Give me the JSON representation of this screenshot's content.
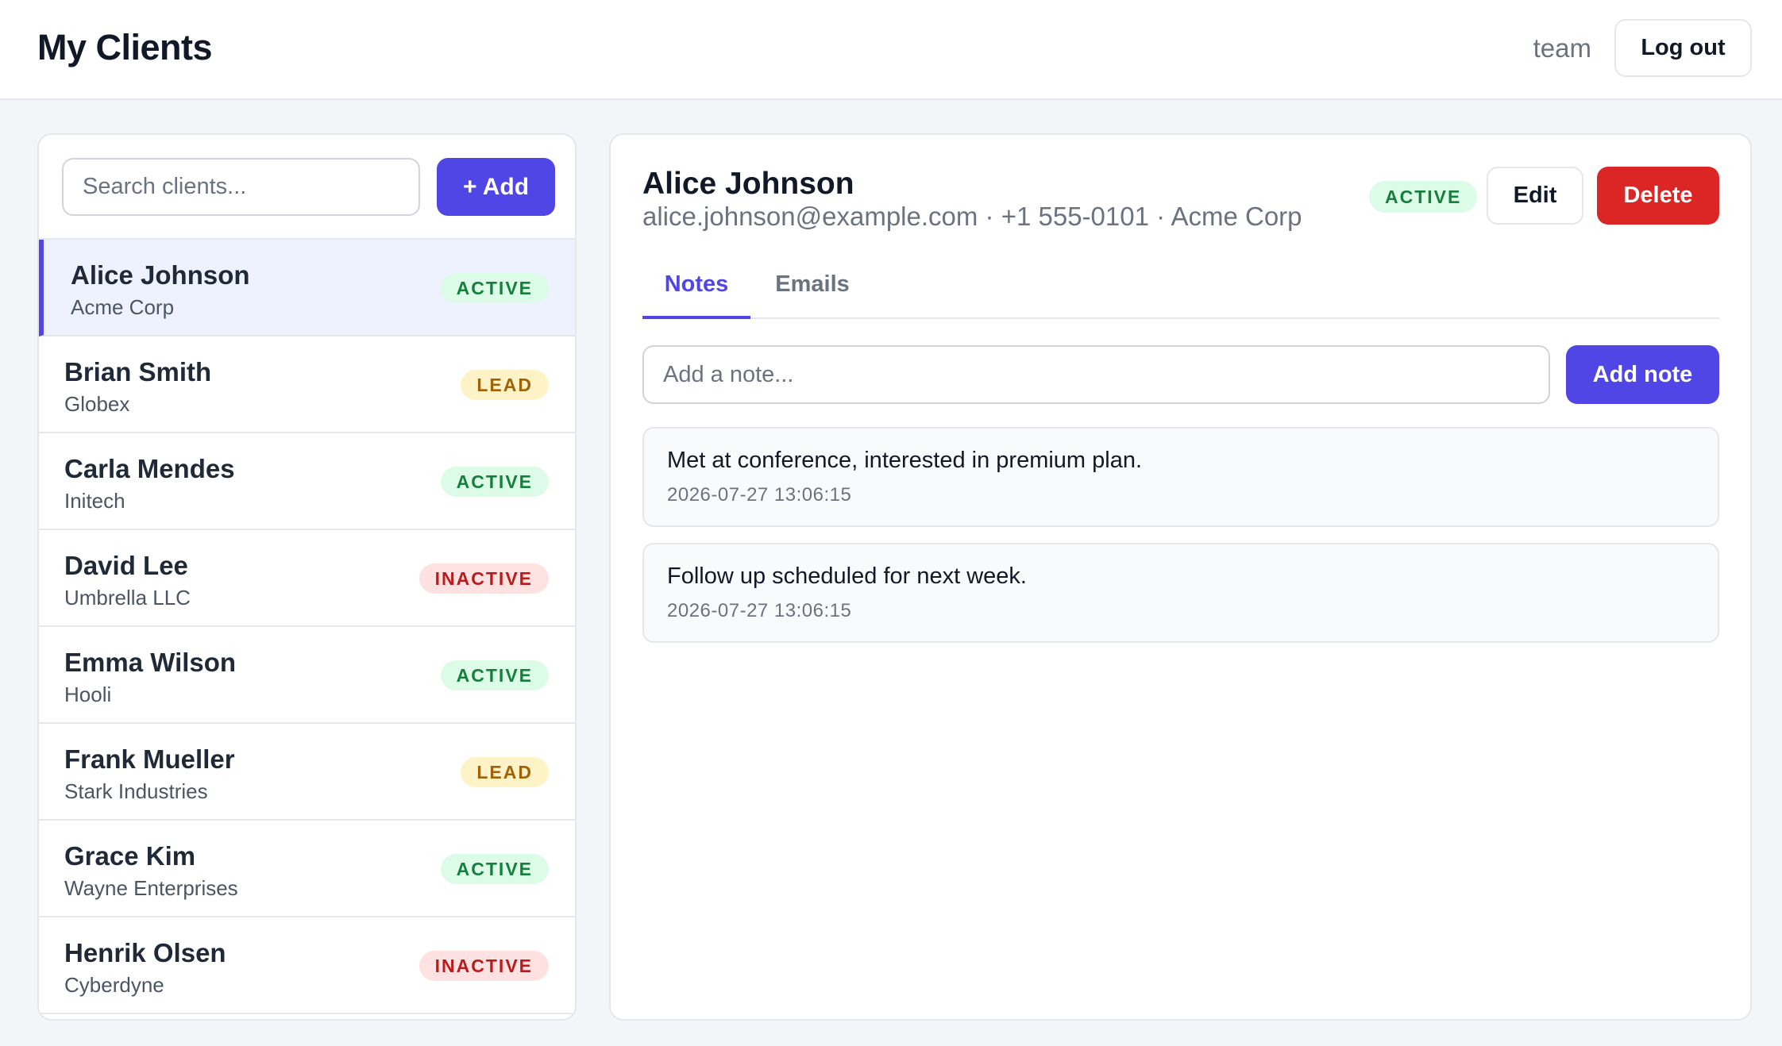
{
  "header": {
    "title": "My Clients",
    "user": "team",
    "logout_label": "Log out"
  },
  "sidebar": {
    "search_placeholder": "Search clients...",
    "add_label": "+ Add",
    "clients": [
      {
        "name": "Alice Johnson",
        "company": "Acme Corp",
        "status": "ACTIVE",
        "selected": true
      },
      {
        "name": "Brian Smith",
        "company": "Globex",
        "status": "LEAD",
        "selected": false
      },
      {
        "name": "Carla Mendes",
        "company": "Initech",
        "status": "ACTIVE",
        "selected": false
      },
      {
        "name": "David Lee",
        "company": "Umbrella LLC",
        "status": "INACTIVE",
        "selected": false
      },
      {
        "name": "Emma Wilson",
        "company": "Hooli",
        "status": "ACTIVE",
        "selected": false
      },
      {
        "name": "Frank Mueller",
        "company": "Stark Industries",
        "status": "LEAD",
        "selected": false
      },
      {
        "name": "Grace Kim",
        "company": "Wayne Enterprises",
        "status": "ACTIVE",
        "selected": false
      },
      {
        "name": "Henrik Olsen",
        "company": "Cyberdyne",
        "status": "INACTIVE",
        "selected": false
      }
    ]
  },
  "detail": {
    "name": "Alice Johnson",
    "meta": "alice.johnson@example.com · +1 555-0101 · Acme Corp",
    "status": "ACTIVE",
    "edit_label": "Edit",
    "delete_label": "Delete",
    "tabs": [
      {
        "label": "Notes",
        "active": true
      },
      {
        "label": "Emails",
        "active": false
      }
    ],
    "note_placeholder": "Add a note...",
    "add_note_label": "Add note",
    "notes": [
      {
        "text": "Met at conference, interested in premium plan.",
        "time": "2026-07-27 13:06:15"
      },
      {
        "text": "Follow up scheduled for next week.",
        "time": "2026-07-27 13:06:15"
      }
    ]
  },
  "colors": {
    "accent": "#4f46e5",
    "danger": "#dc2626",
    "active_bg": "#dcfce7",
    "active_fg": "#15803d",
    "lead_bg": "#fef3c7",
    "lead_fg": "#a16207",
    "inactive_bg": "#fee2e2",
    "inactive_fg": "#b91c1c"
  }
}
